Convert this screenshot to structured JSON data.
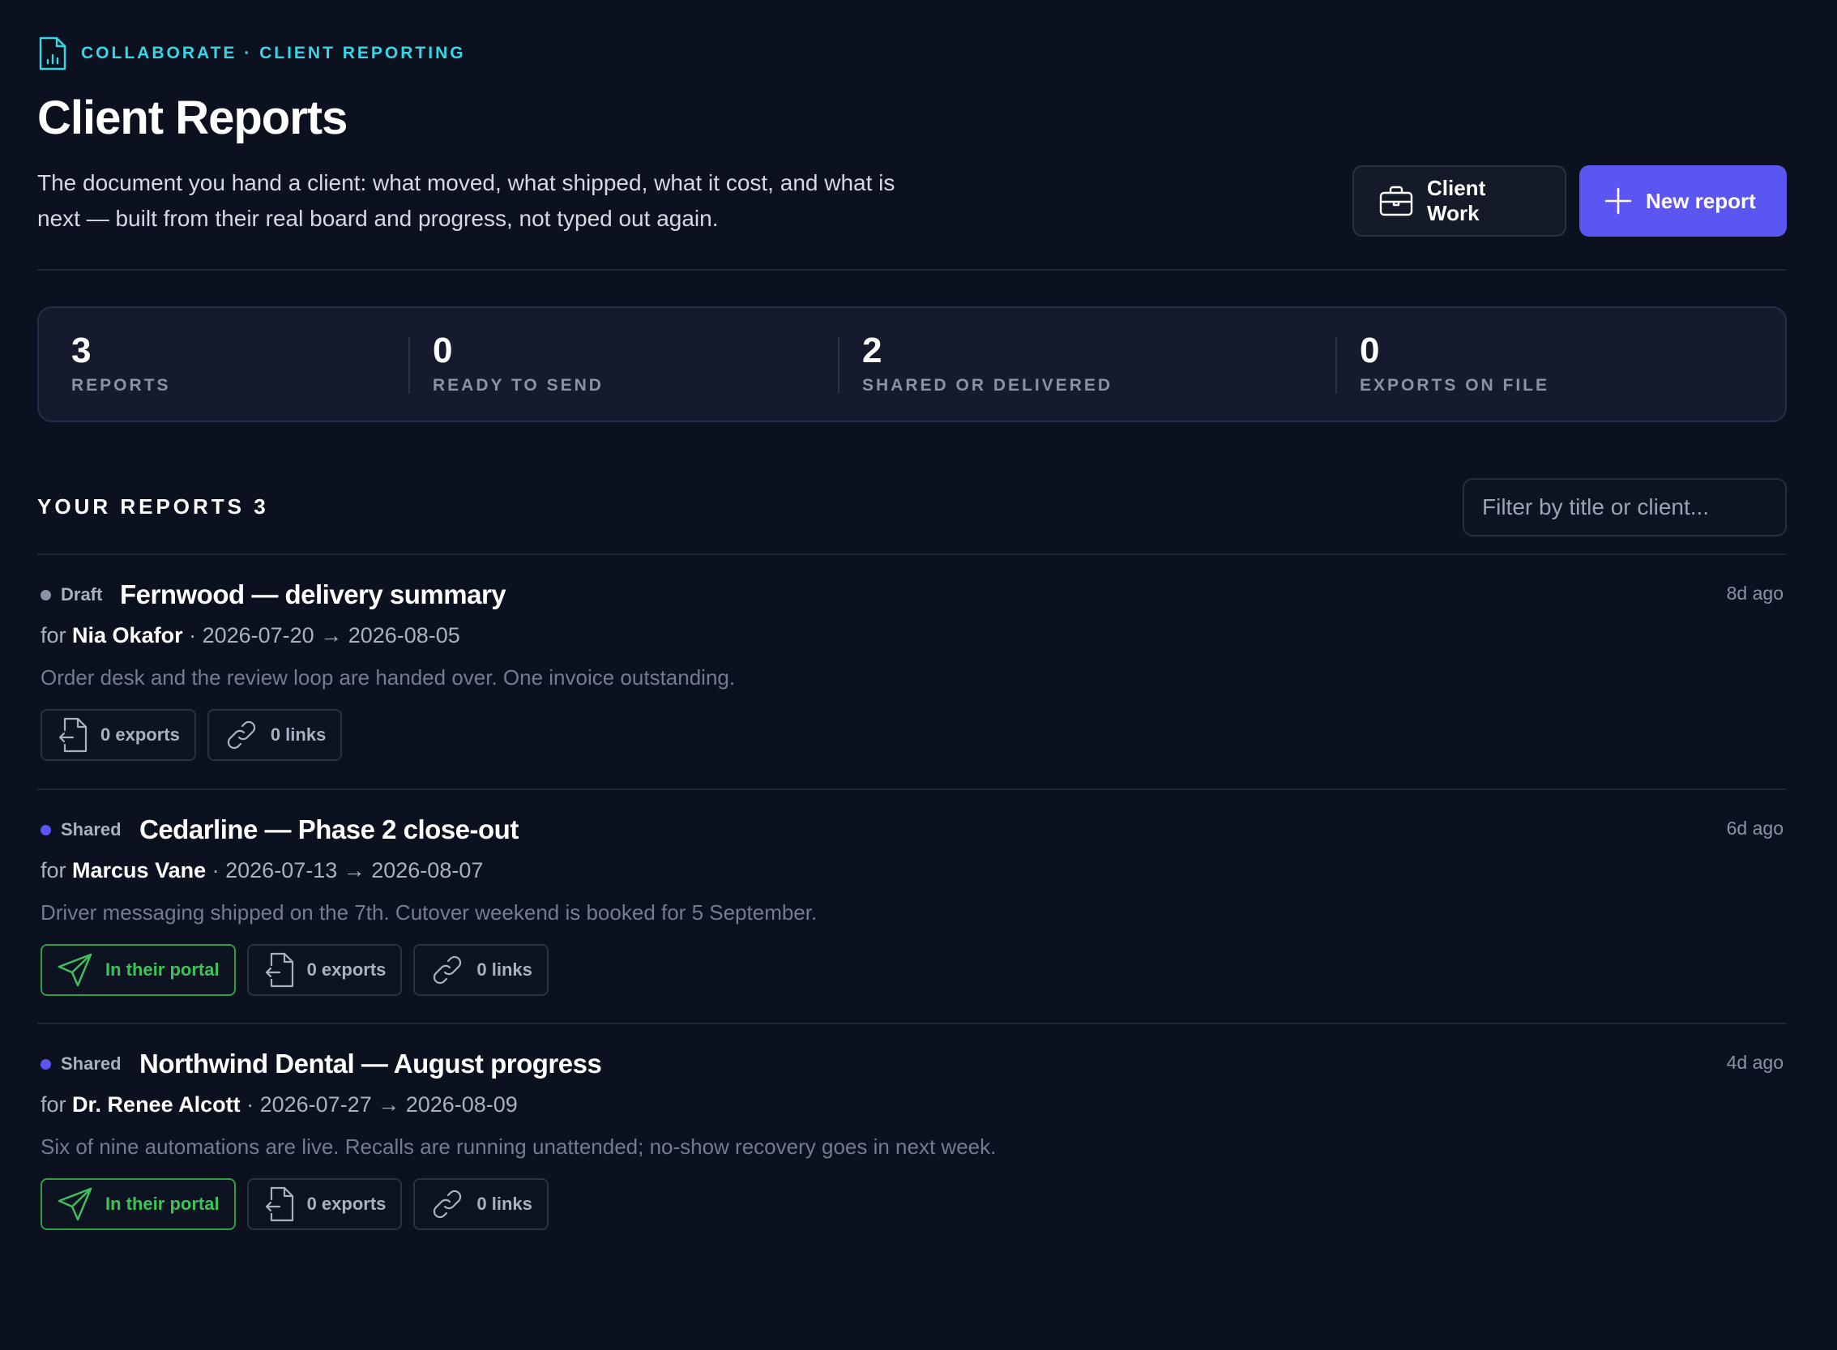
{
  "header": {
    "breadcrumb": "COLLABORATE · CLIENT REPORTING",
    "title": "Client Reports",
    "subtitle": "The document you hand a client: what moved, what shipped, what it cost, and what is next — built from their real board and progress, not typed out again.",
    "client_work_label": "Client Work",
    "new_report_label": "New report"
  },
  "stats": [
    {
      "value": "3",
      "label": "REPORTS"
    },
    {
      "value": "0",
      "label": "READY TO SEND"
    },
    {
      "value": "2",
      "label": "SHARED OR DELIVERED"
    },
    {
      "value": "0",
      "label": "EXPORTS ON FILE"
    }
  ],
  "list": {
    "title": "YOUR REPORTS",
    "count": "3",
    "filter_placeholder": "Filter by title or client..."
  },
  "reports": [
    {
      "status": "Draft",
      "status_color": "#8a93a6",
      "title": "Fernwood — delivery summary",
      "for_label": "for",
      "client": "Nia Okafor",
      "range": "· 2026-07-20 → 2026-08-05",
      "summary": "Order desk and the review loop are handed over. One invoice outstanding.",
      "when": "8d ago",
      "portal": null,
      "exports": "0 exports",
      "links": "0 links"
    },
    {
      "status": "Shared",
      "status_color": "#5b55f2",
      "title": "Cedarline — Phase 2 close-out",
      "for_label": "for",
      "client": "Marcus Vane",
      "range": "· 2026-07-13 → 2026-08-07",
      "summary": "Driver messaging shipped on the 7th. Cutover weekend is booked for 5 September.",
      "when": "6d ago",
      "portal": "In their portal",
      "exports": "0 exports",
      "links": "0 links"
    },
    {
      "status": "Shared",
      "status_color": "#5b55f2",
      "title": "Northwind Dental — August progress",
      "for_label": "for",
      "client": "Dr. Renee Alcott",
      "range": "· 2026-07-27 → 2026-08-09",
      "summary": "Six of nine automations are live. Recalls are running unattended; no-show recovery goes in next week.",
      "when": "4d ago",
      "portal": "In their portal",
      "exports": "0 exports",
      "links": "0 links"
    }
  ]
}
